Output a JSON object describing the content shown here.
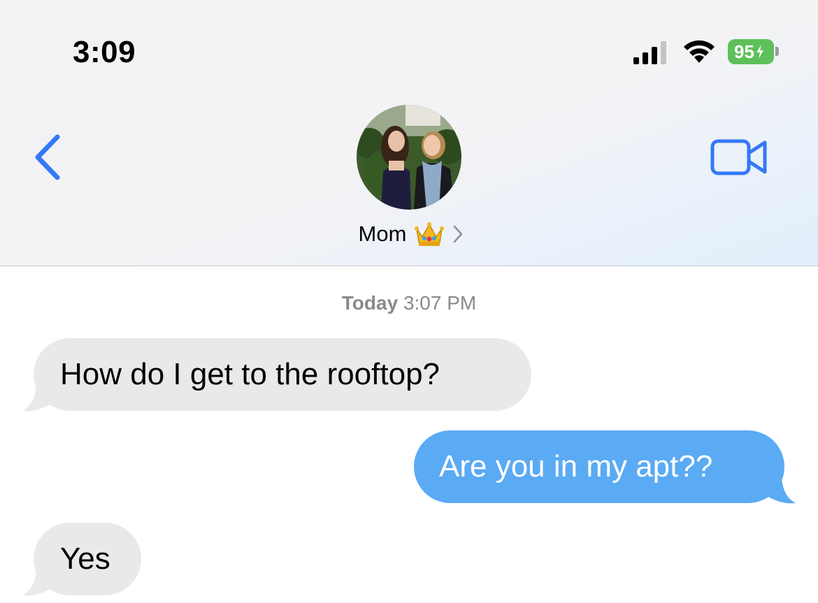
{
  "status_bar": {
    "time": "3:09",
    "battery": "95",
    "signal_icon": "cellular-signal-icon",
    "wifi_icon": "wifi-icon"
  },
  "nav": {
    "back_icon": "chevron-left-icon",
    "video_icon": "video-camera-icon",
    "contact_name": "Mom",
    "contact_emoji": "crown-icon",
    "accent_color": "#3478f6"
  },
  "conversation": {
    "timestamp_day": "Today",
    "timestamp_time": "3:07 PM",
    "messages": [
      {
        "direction": "received",
        "text": "How do I get to the rooftop?"
      },
      {
        "direction": "sent",
        "text": "Are you in my apt??"
      },
      {
        "direction": "received",
        "text": "Yes"
      }
    ],
    "colors": {
      "received_bubble": "#e9e9eb",
      "sent_bubble": "#5aaaf4"
    }
  }
}
